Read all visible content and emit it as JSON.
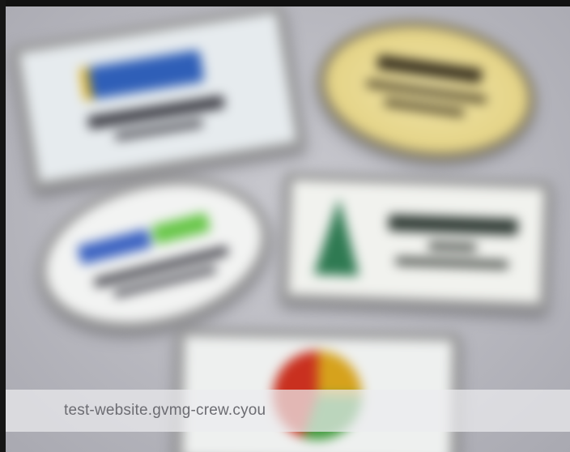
{
  "image": {
    "subject": "name-badges-photo",
    "badges": [
      {
        "shape": "rectangle",
        "frame": "silver"
      },
      {
        "shape": "oval",
        "frame": "gold"
      },
      {
        "shape": "oval",
        "frame": "silver"
      },
      {
        "shape": "rectangle",
        "frame": "silver"
      },
      {
        "shape": "rectangle",
        "frame": "silver"
      }
    ]
  },
  "caption": {
    "text": "test-website.gvmg-crew.cyou"
  },
  "colors": {
    "background": "#c2c2c8",
    "caption_bar": "#ebebee",
    "caption_text": "#6c6c72"
  }
}
